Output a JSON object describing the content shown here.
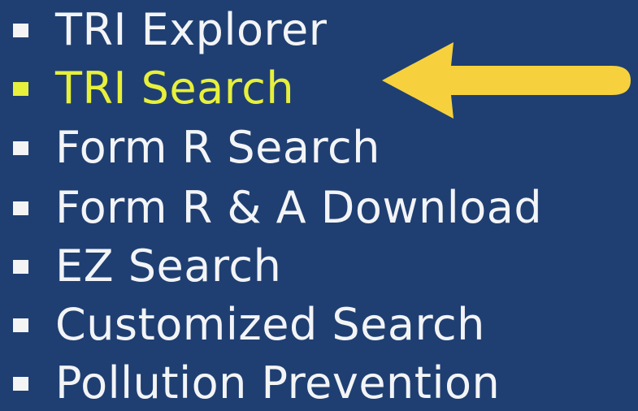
{
  "colors": {
    "background": "#1f3f72",
    "link_text": "#f3f4f6",
    "active_link_text": "#e7f03b",
    "bullet": "#f4f4f5",
    "active_bullet": "#e7f03b",
    "arrow": "#f6d13d"
  },
  "nav": {
    "items": [
      {
        "label": "TRI Explorer",
        "active": false
      },
      {
        "label": "TRI Search",
        "active": true
      },
      {
        "label": "Form R Search",
        "active": false
      },
      {
        "label": "Form R & A Download",
        "active": false
      },
      {
        "label": "EZ Search",
        "active": false
      },
      {
        "label": "Customized Search",
        "active": false
      },
      {
        "label": "Pollution Prevention",
        "active": false
      }
    ]
  },
  "annotation": {
    "arrow_icon": "left-arrow-icon"
  }
}
